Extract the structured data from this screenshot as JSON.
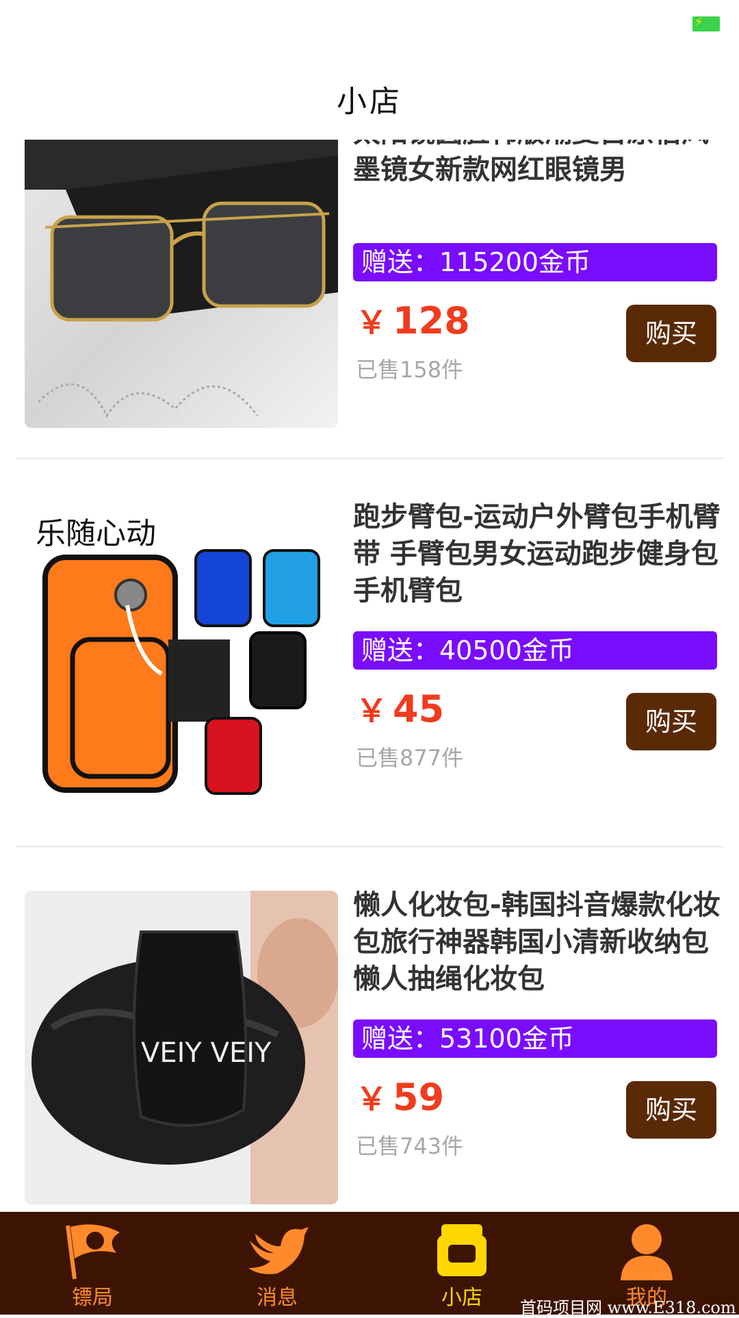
{
  "status_bar": {
    "battery_icon": "battery-charging-icon",
    "battery_color": "#3bd34a"
  },
  "header": {
    "title": "小店"
  },
  "products": [
    {
      "title": "太阳镜圆脸韩版潮复古原宿风墨镜女新款网红眼镜男",
      "gift": "赠送：115200金币",
      "currency": "￥",
      "price": "128",
      "sold": "已售158件",
      "buy_label": "购买",
      "image": "sunglasses-photo"
    },
    {
      "title": "跑步臂包-运动户外臂包手机臂带 手臂包男女运动跑步健身包手机臂包",
      "gift": "赠送：40500金币",
      "currency": "￥",
      "price": "45",
      "sold": "已售877件",
      "buy_label": "购买",
      "image": "armband-photo",
      "image_text": "乐随心动"
    },
    {
      "title": "懒人化妆包-韩国抖音爆款化妆包旅行神器韩国小清新收纳包懒人抽绳化妆包",
      "gift": "赠送：53100金币",
      "currency": "￥",
      "price": "59",
      "sold": "已售743件",
      "buy_label": "购买",
      "image": "cosmetic-bag-photo",
      "image_text": "VEIY VEIY"
    }
  ],
  "tabbar": {
    "tabs": [
      {
        "label": "镖局",
        "icon": "flag-icon",
        "active": false
      },
      {
        "label": "消息",
        "icon": "bird-icon",
        "active": false
      },
      {
        "label": "小店",
        "icon": "shop-icon",
        "active": true
      },
      {
        "label": "我的",
        "icon": "user-icon",
        "active": false
      }
    ],
    "background": "#3d1404",
    "active_color": "#ffd700",
    "inactive_color": "#ff8a2c"
  },
  "watermark": "首码项目网 www.E318.com",
  "colors": {
    "gift_bg": "#7a0cff",
    "price": "#f03c1e",
    "buy_bg": "#5a2a06"
  }
}
